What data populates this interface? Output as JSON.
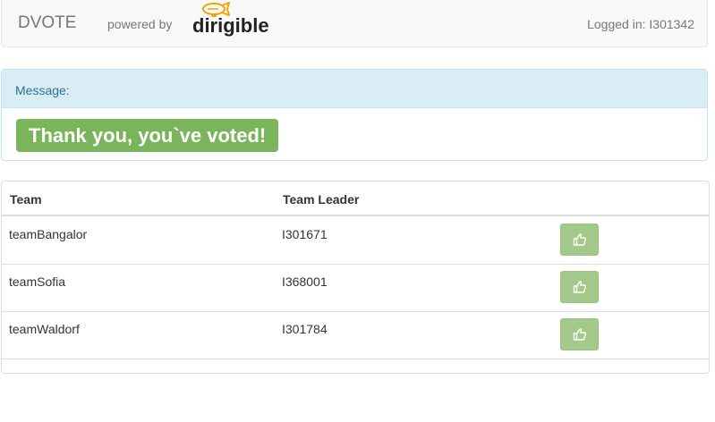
{
  "navbar": {
    "brand": "DVOTE",
    "powered_by": "powered by",
    "logo_text": "dirigible",
    "logged_in": "Logged in: I301342"
  },
  "message": {
    "heading": "Message:",
    "text": "Thank you, you`ve voted!"
  },
  "table": {
    "headers": [
      "Team",
      "Team Leader",
      ""
    ],
    "rows": [
      {
        "team": "teamBangalor",
        "leader": "I301671",
        "vote_icon": "thumbs-up-icon"
      },
      {
        "team": "teamSofia",
        "leader": "I368001",
        "vote_icon": "thumbs-up-icon"
      },
      {
        "team": "teamWaldorf",
        "leader": "I301784",
        "vote_icon": "thumbs-up-icon"
      }
    ]
  },
  "colors": {
    "success": "#7ab55c",
    "vote_button": "#a3c98a",
    "info_heading_bg": "#d9edf7",
    "logo_blimp": "#f0a500"
  }
}
